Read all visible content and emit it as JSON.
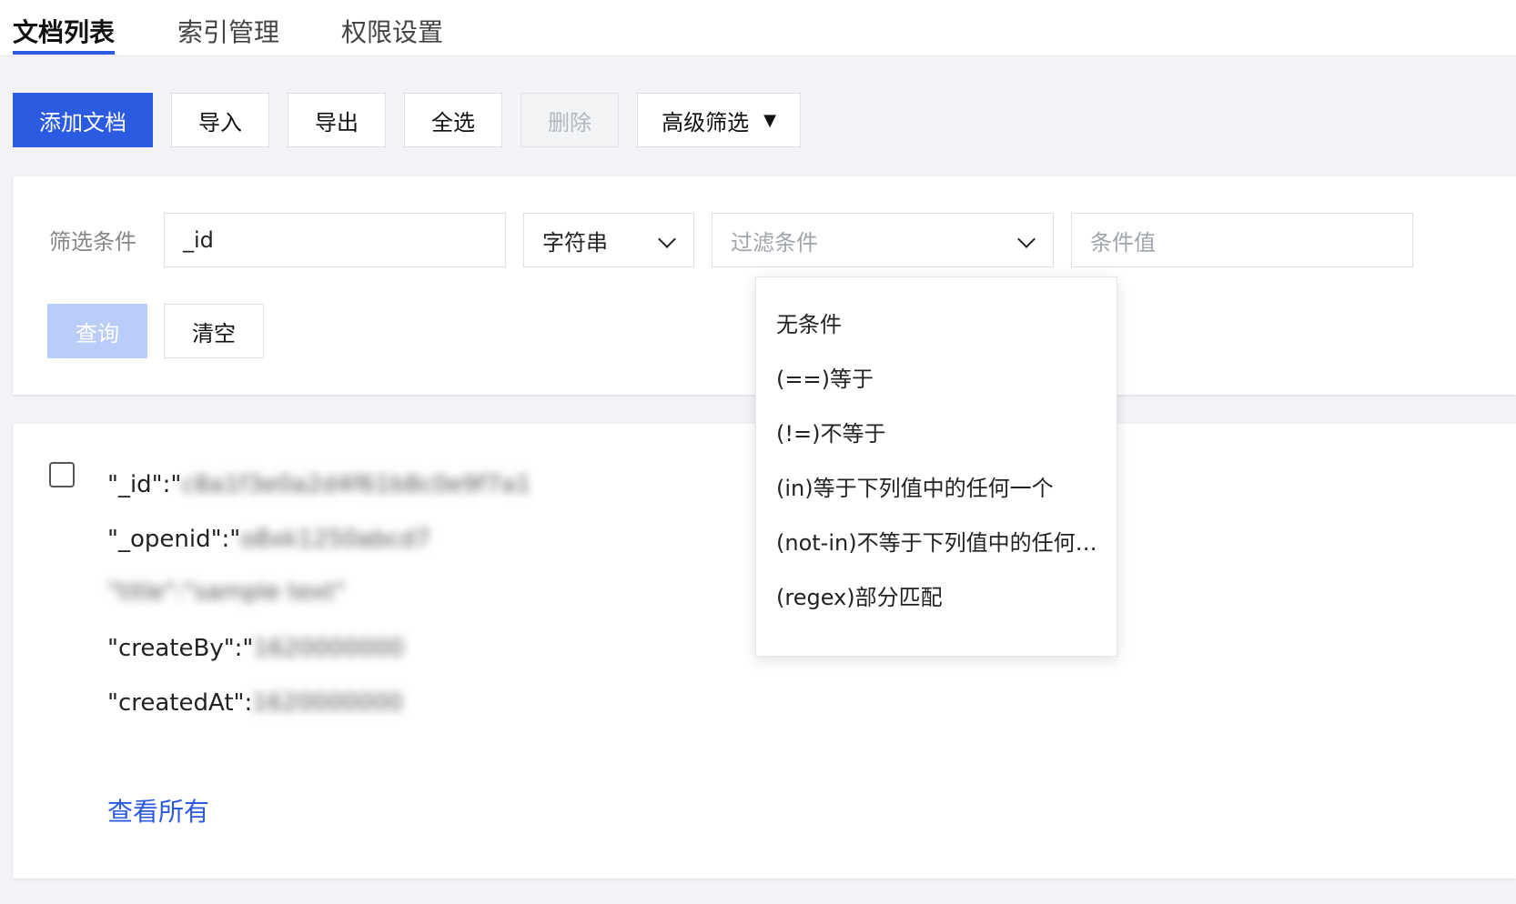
{
  "tabs": [
    {
      "label": "文档列表",
      "active": true
    },
    {
      "label": "索引管理",
      "active": false
    },
    {
      "label": "权限设置",
      "active": false
    }
  ],
  "toolbar": {
    "add_label": "添加文档",
    "import_label": "导入",
    "export_label": "导出",
    "select_all_label": "全选",
    "delete_label": "删除",
    "advanced_filter_label": "高级筛选",
    "caret": "▼"
  },
  "filter": {
    "label": "筛选条件",
    "field_value": "_id",
    "type_value": "字符串",
    "condition_placeholder": "过滤条件",
    "value_placeholder": "条件值",
    "query_label": "查询",
    "clear_label": "清空"
  },
  "condition_options": [
    "无条件",
    "(==)等于",
    "(!=)不等于",
    "(in)等于下列值中的任何一个",
    "(not-in)不等于下列值中的任何一个",
    "(regex)部分匹配"
  ],
  "document": {
    "lines": [
      {
        "key": "\"_id\":\"",
        "redacted": "c8a1f3e0a2d4f61b8c0e9f7a1"
      },
      {
        "key": "\"_openid\":\"",
        "redacted": "o8xk1250abcd7"
      },
      {
        "key": "",
        "redacted": "\"title\":\"sample text\""
      },
      {
        "key": "\"createBy\":\"",
        "redacted": "1620000000"
      },
      {
        "key": "\"createdAt\":",
        "redacted": "1620000000"
      }
    ],
    "view_all_label": "查看所有"
  },
  "colors": {
    "primary": "#2b5be1",
    "primary_disabled": "#b9cdf8",
    "background": "#f3f4f7"
  }
}
